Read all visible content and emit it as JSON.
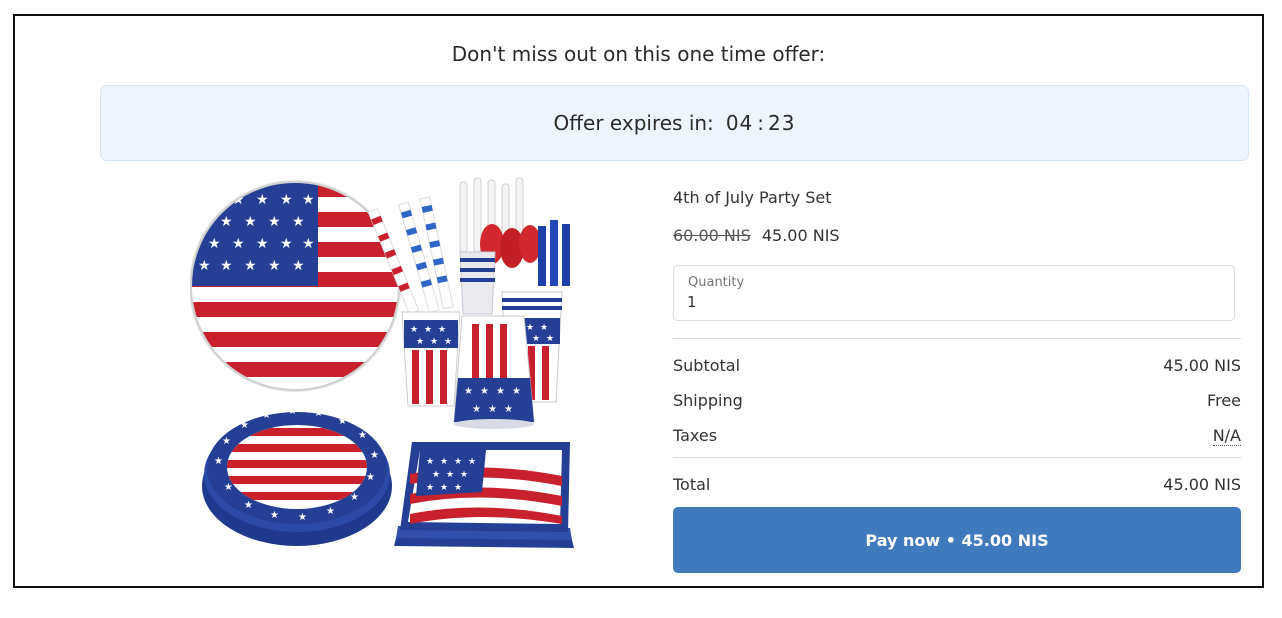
{
  "offer": {
    "headline": "Don't miss out on this one time offer:",
    "timer_label": "Offer expires in:",
    "minutes": "04",
    "separator": ":",
    "seconds": "23"
  },
  "product": {
    "title": "4th of July Party Set",
    "old_price": "60.00 NIS",
    "new_price": "45.00 NIS",
    "image_icon": "party-tableware-image"
  },
  "quantity": {
    "label": "Quantity",
    "value": "1"
  },
  "summary": {
    "subtotal_label": "Subtotal",
    "subtotal_value": "45.00 NIS",
    "shipping_label": "Shipping",
    "shipping_value": "Free",
    "taxes_label": "Taxes",
    "taxes_value": "N/A",
    "total_label": "Total",
    "total_value": "45.00 NIS"
  },
  "pay_button": {
    "label": "Pay now • 45.00 NIS"
  },
  "colors": {
    "accent": "#3f7abc",
    "timer_bg": "#eef5fd",
    "flag_red": "#c8202c",
    "flag_blue": "#243f93"
  }
}
